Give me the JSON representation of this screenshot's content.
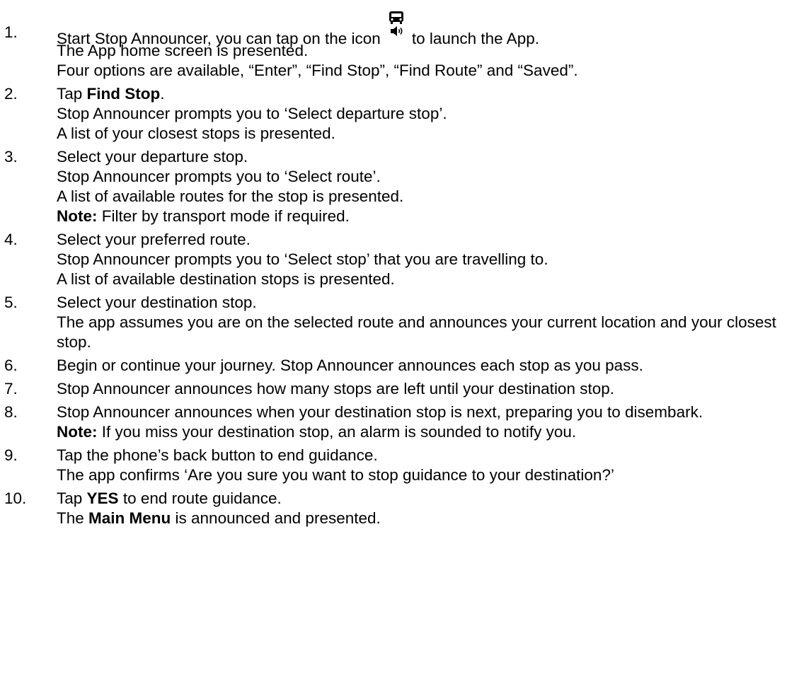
{
  "steps": [
    {
      "number": "1.",
      "line1_pre": "Start Stop Announcer, you can tap on the icon",
      "line1_post": "to launch the App.",
      "icon": "bus-speaker-app-icon",
      "line2": "The App home screen is presented.",
      "line3": "Four options are available, “Enter”, “Find Stop”, “Find Route” and “Saved”."
    },
    {
      "number": "2.",
      "l1_pre": "Tap ",
      "l1_bold": "Find Stop",
      "l1_post": ".",
      "line2": "Stop Announcer prompts you to ‘Select departure stop’.",
      "line3": "A list of your closest stops is presented."
    },
    {
      "number": "3.",
      "line1": "Select your departure stop.",
      "line2": "Stop Announcer prompts you to ‘Select route’.",
      "line3": "A list of available routes for the stop is presented.",
      "note_label": "Note:",
      "note_text": " Filter by transport mode if required."
    },
    {
      "number": "4.",
      "line1": "Select your preferred route.",
      "line2": "Stop Announcer prompts you to ‘Select stop’ that you are travelling to.",
      "line3": "A list of available destination stops is presented."
    },
    {
      "number": "5.",
      "line1": "Select your destination stop.",
      "line2": "The app assumes you are on the selected route and announces your current location and your closest stop."
    },
    {
      "number": "6.",
      "line1": "Begin or continue your journey. Stop Announcer announces each stop as you pass."
    },
    {
      "number": "7.",
      "line1": "Stop Announcer announces how many stops are left until your destination stop."
    },
    {
      "number": "8.",
      "line1": "Stop Announcer announces when your destination stop is next, preparing you to disembark.",
      "note_label": "Note:",
      "note_text": " If you miss your destination stop, an alarm is sounded to notify you."
    },
    {
      "number": "9.",
      "line1": "Tap the phone’s back button to end guidance.",
      "line2": "The app confirms ‘Are you sure you want to stop guidance to your destination?’"
    },
    {
      "number": "10.",
      "l1_pre": "Tap ",
      "l1_bold": "YES",
      "l1_post": " to end route guidance.",
      "l2_pre": "The ",
      "l2_bold": "Main Menu",
      "l2_post": " is announced and presented."
    }
  ]
}
